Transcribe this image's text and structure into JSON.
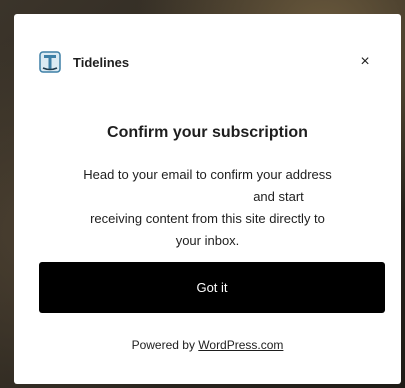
{
  "modal": {
    "site_name": "Tidelines",
    "close_label": "×",
    "title": "Confirm your subscription",
    "message_line1": "Head to your email to confirm your address",
    "message_masked": "                              ",
    "message_line2": "and start",
    "message_line3": "receiving content from this site directly to",
    "message_line4": "your inbox.",
    "button_label": "Got it",
    "footer_prefix": "Powered by ",
    "footer_link": "WordPress.com"
  },
  "colors": {
    "primary_button": "#000000",
    "logo_blue": "#3d7fa6"
  },
  "icons": {
    "logo": "tidelines-logo-icon",
    "close": "close-icon"
  }
}
